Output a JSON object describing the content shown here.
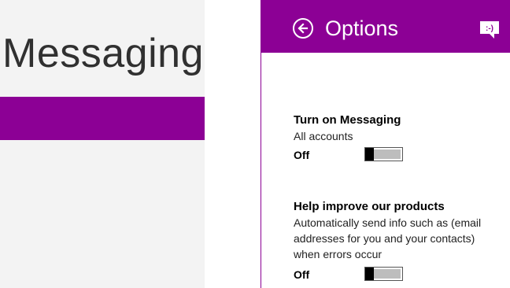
{
  "app": {
    "title": "Messaging"
  },
  "colors": {
    "accent": "#8c0095",
    "left_pane_bg": "#f3f3f3"
  },
  "flyout": {
    "title": "Options",
    "back_icon": "back-arrow-circle-icon",
    "app_icon": "messaging-smiley-icon",
    "settings": [
      {
        "heading": "Turn on Messaging",
        "description": "All accounts",
        "state": "Off",
        "toggle_on": false
      },
      {
        "heading": "Help improve our products",
        "description": "Automatically send info such as (email addresses for you and your contacts) when errors occur",
        "state": "Off",
        "toggle_on": false
      }
    ]
  }
}
